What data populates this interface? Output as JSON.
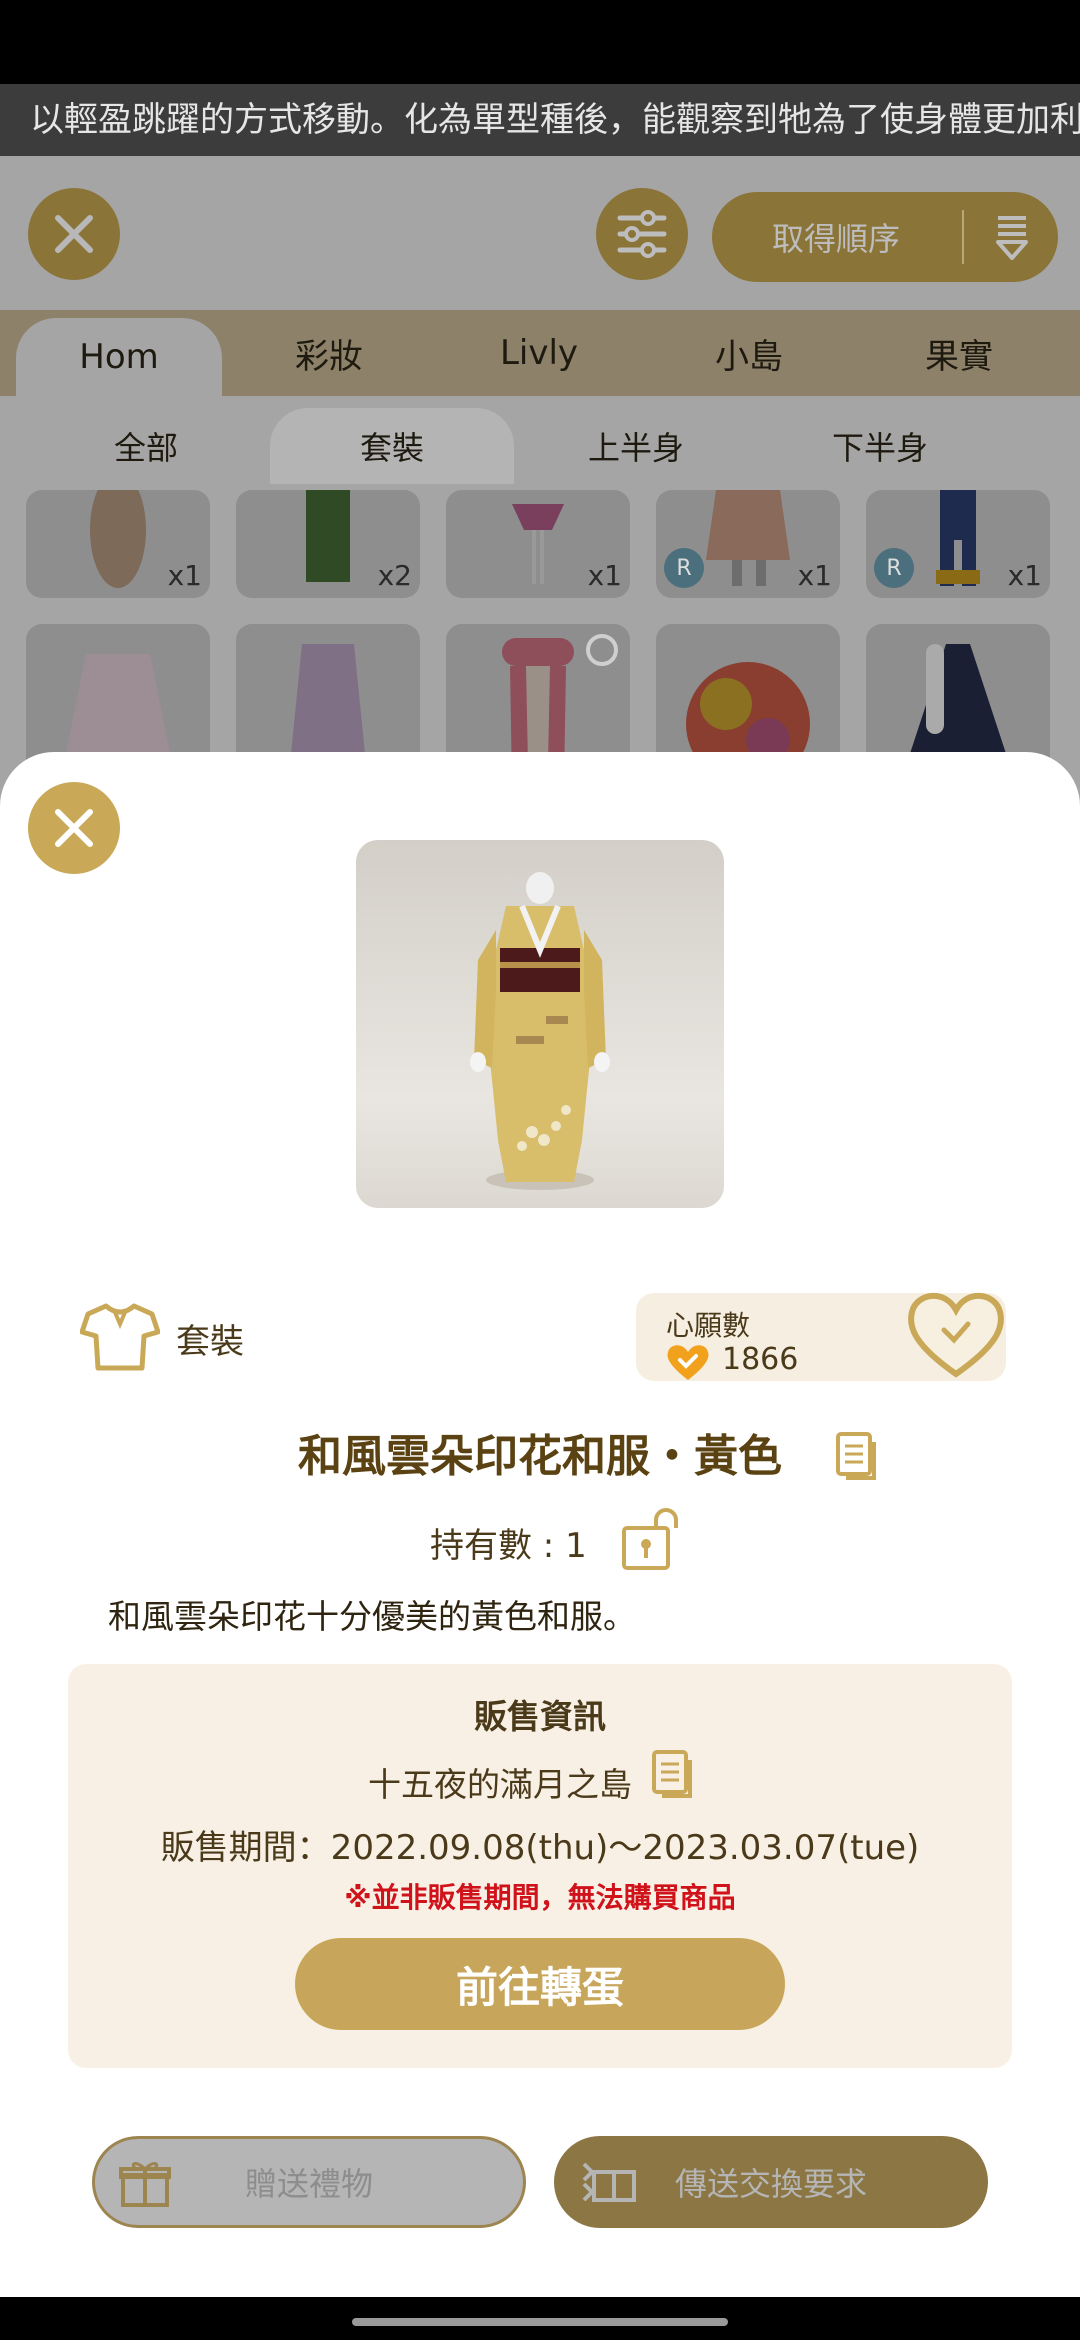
{
  "marquee": {
    "text": "以輕盈跳躍的方式移動。化為單型種後，能觀察到牠為了使身體更加利"
  },
  "toolbar": {
    "order_label": "取得順序"
  },
  "categories": [
    {
      "label": "Hom"
    },
    {
      "label": "彩妝"
    },
    {
      "label": "Livly"
    },
    {
      "label": "小島"
    },
    {
      "label": "果實"
    }
  ],
  "subtabs": [
    {
      "label": "全部"
    },
    {
      "label": "套裝"
    },
    {
      "label": "上半身"
    },
    {
      "label": "下半身"
    }
  ],
  "grid": {
    "row1": [
      {
        "qty": "x1",
        "badge": ""
      },
      {
        "qty": "x2",
        "badge": ""
      },
      {
        "qty": "x1",
        "badge": ""
      },
      {
        "qty": "x1",
        "badge": "R"
      },
      {
        "qty": "x1",
        "badge": "R"
      }
    ]
  },
  "detail": {
    "category": "套裝",
    "wish_title": "心願數",
    "wish_count": "1866",
    "item_name": "和風雲朵印花和服・黃色",
    "owned": "持有數 : 1",
    "description": "和風雲朵印花十分優美的黃色和服。",
    "sale": {
      "title": "販售資訊",
      "island": "十五夜的滿月之島",
      "period": "販售期間：2022.09.08(thu)～2023.03.07(tue)",
      "warning": "※並非販售期間，無法購買商品",
      "gacha_button": "前往轉蛋"
    },
    "gift_button": "贈送禮物",
    "trade_button": "傳送交換要求"
  },
  "colors": {
    "accent": "#c9a857",
    "warning": "#d0121b",
    "title": "#5a4212"
  }
}
